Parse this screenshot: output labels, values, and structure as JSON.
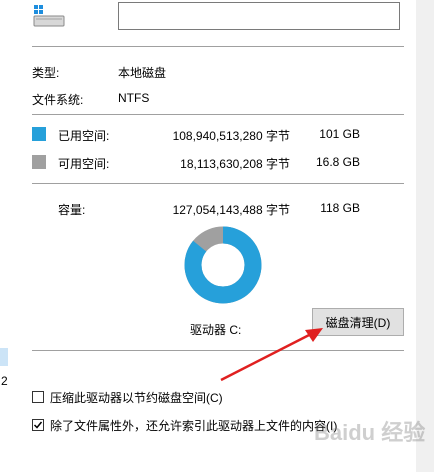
{
  "window": {
    "accent_color": "#26a0da",
    "free_color": "#a0a0a0"
  },
  "left_edge": {
    "number": "2"
  },
  "general": {
    "name_value": "",
    "type_label": "类型:",
    "type_value": "本地磁盘",
    "fs_label": "文件系统:",
    "fs_value": "NTFS"
  },
  "usage": {
    "used": {
      "label": "已用空间:",
      "bytes": "108,940,513,280 字节",
      "size": "101 GB"
    },
    "free": {
      "label": "可用空间:",
      "bytes": "18,113,630,208 字节",
      "size": "16.8 GB"
    },
    "capacity": {
      "label": "容量:",
      "bytes": "127,054,143,488 字节",
      "size": "118 GB"
    },
    "used_fraction": 0.857
  },
  "drive": {
    "label": "驱动器 C:"
  },
  "cleanup_button": {
    "label": "磁盘清理(D)"
  },
  "options": {
    "compress": {
      "label": "压缩此驱动器以节约磁盘空间(C)",
      "checked": false
    },
    "index": {
      "label": "除了文件属性外，还允许索引此驱动器上文件的内容(I)",
      "checked": true
    }
  },
  "watermark": {
    "text": "Baidu 经验"
  }
}
